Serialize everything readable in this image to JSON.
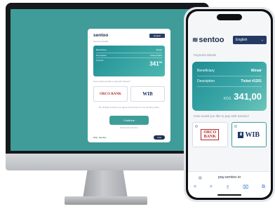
{
  "desktop": {
    "brand": "sentoo",
    "language": "English",
    "payment_details_label": "Payment details",
    "beneficiary_label": "Beneficiary",
    "beneficiary_value": "Winair",
    "description_label": "Description",
    "description_value": "Ticket #1201",
    "amount_label": "Amount",
    "amount_whole": "341",
    "amount_decimal": "50",
    "choose_prompt": "How would you like to pay with Sentoo?",
    "bank1": "ORCO BANK",
    "bank2": "WIB",
    "terms_text": "By clicking continue you agree and consent to our security policy",
    "continue_label": "Continue",
    "secured_label": "Secured by Sentoo",
    "faq_label": "FAQ",
    "security_label": "Security",
    "chat_label": "Chat"
  },
  "phone": {
    "brand": "sentoo",
    "language": "English",
    "payment_details_label": "Payment details",
    "beneficiary_label": "Beneficiary",
    "beneficiary_value": "Winair",
    "description_label": "Description",
    "description_value": "Ticket #1201",
    "currency": "XCG",
    "amount": "341,00",
    "choose_prompt": "How would you like to pay with Sentoo?",
    "bank1_line1": "ORCO",
    "bank1_line2": "BANK",
    "bank2": "WIB",
    "url": "pay.sentoo.io",
    "nav": {
      "back": "<",
      "forward": ">",
      "share": "⇪",
      "bookmarks": "⌧",
      "tabs": "⧉"
    }
  }
}
